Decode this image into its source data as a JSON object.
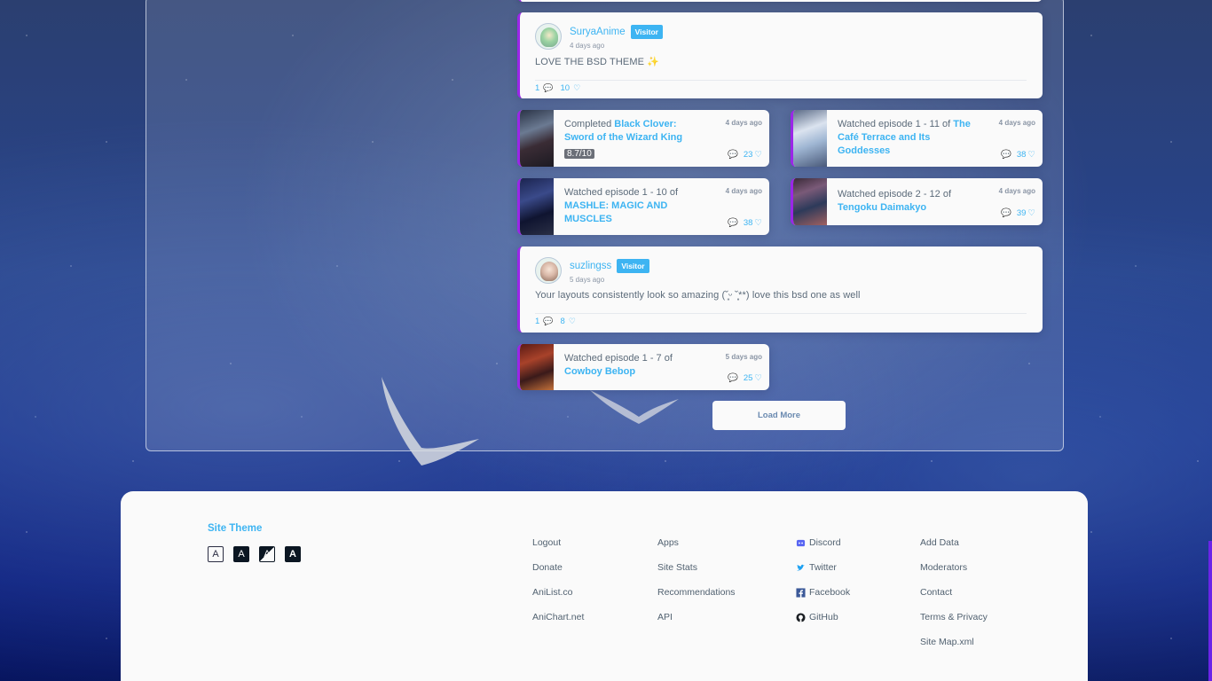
{
  "posts": [
    {
      "username": "SuryaAnime",
      "badge": "Visitor",
      "time": "4 days ago",
      "text": "LOVE THE BSD THEME ✨",
      "replies": "1",
      "likes": "10"
    },
    {
      "username": "suzlingss",
      "badge": "Visitor",
      "time": "5 days ago",
      "text": "Your layouts consistently look so amazing (˘͈ᵕ ˘͈**) love this bsd one as well",
      "replies": "1",
      "likes": "8"
    }
  ],
  "activities": [
    {
      "prefix": "Completed ",
      "title": "Black Clover: Sword of the Wizard King",
      "score": "8.7/10",
      "time": "4 days ago",
      "replies": "",
      "likes": "23"
    },
    {
      "prefix": "Watched episode 1 - 11 of ",
      "title": "The Café Terrace and Its Goddesses",
      "time": "4 days ago",
      "replies": "",
      "likes": "38"
    },
    {
      "prefix": "Watched episode 1 - 10 of ",
      "title": "MASHLE: MAGIC AND MUSCLES",
      "time": "4 days ago",
      "replies": "",
      "likes": "38"
    },
    {
      "prefix": "Watched episode 2 - 12 of ",
      "title": "Tengoku Daimakyo",
      "time": "4 days ago",
      "replies": "",
      "likes": "39"
    },
    {
      "prefix": "Watched episode 1 - 7 of ",
      "title": "Cowboy Bebop",
      "time": "5 days ago",
      "replies": "",
      "likes": "25"
    }
  ],
  "load_more_label": "Load More",
  "footer": {
    "site_theme_title": "Site Theme",
    "theme_options": [
      "A",
      "A",
      "A",
      "A"
    ],
    "col1": [
      "Logout",
      "Donate",
      "AniList.co",
      "AniChart.net"
    ],
    "col2": [
      "Apps",
      "Site Stats",
      "Recommendations",
      "API"
    ],
    "col3": [
      "Discord",
      "Twitter",
      "Facebook",
      "GitHub"
    ],
    "col4": [
      "Add Data",
      "Moderators",
      "Contact",
      "Terms & Privacy",
      "Site Map.xml"
    ]
  },
  "colors": {
    "accent": "#3db4f2",
    "activity_border": "#9b26e8",
    "footer_bg": "#fafafa"
  },
  "icons": [
    "comment-icon",
    "heart-icon",
    "discord-icon",
    "twitter-icon",
    "facebook-icon",
    "github-icon"
  ]
}
